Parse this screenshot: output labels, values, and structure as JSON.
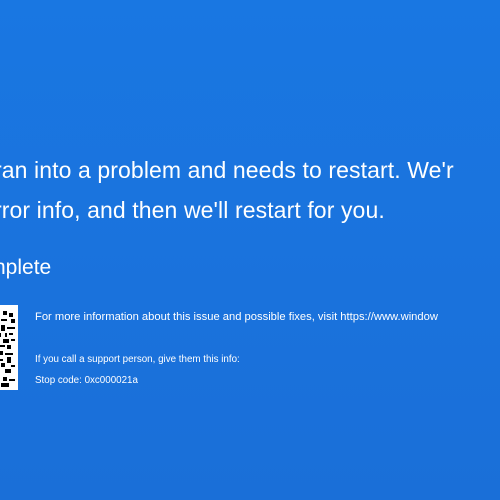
{
  "bsod": {
    "message_line1": "ran into a problem and needs to restart. We'r",
    "message_line2": "rror info, and then we'll restart for you.",
    "progress_text": "nplete",
    "more_info_text": "For more information about this issue and possible fixes, visit https://www.window",
    "support_text": "If you call a support person, give them this info:",
    "stop_code_text": "Stop code: 0xc000021a",
    "qr_icon": "qr-code-icon",
    "background_color": "#1a75e0",
    "text_color": "#ffffff"
  }
}
